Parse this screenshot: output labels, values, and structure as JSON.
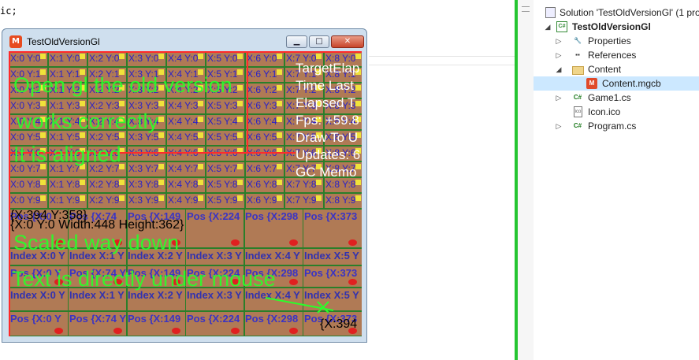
{
  "editor": {
    "code_fragment": "ic;"
  },
  "solution_explorer": {
    "items": [
      {
        "label": "Solution 'TestOldVersionGl' (1 pro",
        "icon": "solution-icon"
      },
      {
        "label": "TestOldVersionGl",
        "icon": "csharp-project-icon"
      },
      {
        "label": "Properties",
        "icon": "wrench-icon"
      },
      {
        "label": "References",
        "icon": "references-icon"
      },
      {
        "label": "Content",
        "icon": "folder-icon"
      },
      {
        "label": "Content.mgcb",
        "icon": "monogame-icon"
      },
      {
        "label": "Game1.cs",
        "icon": "csharp-file-icon"
      },
      {
        "label": "Icon.ico",
        "icon": "image-file-icon"
      },
      {
        "label": "Program.cs",
        "icon": "csharp-file-icon"
      }
    ]
  },
  "game_window": {
    "title": "TestOldVersionGl",
    "icon_glyph": "M",
    "buttons": {
      "minimize": "▁",
      "maximize": "□",
      "close": "✕"
    },
    "grid_labels": [
      [
        "X:0 Y:0",
        "X:1 Y:0",
        "X:2 Y:0",
        "X:3 Y:0",
        "X:4 Y:0",
        "X:5 Y:0",
        "X:6 Y:0",
        "X:7 Y:0",
        "X:8 Y:0"
      ],
      [
        "X:0 Y:1",
        "X:1 Y:1",
        "X:2 Y:1",
        "X:3 Y:1",
        "X:4 Y:1",
        "X:5 Y:1",
        "X:6 Y:1",
        "X:7 Y:1",
        "X:8 Y:1"
      ],
      [
        "X:0 Y:2",
        "X:1 Y:2",
        "X:2 Y:2",
        "X:3 Y:2",
        "X:4 Y:2",
        "X:5 Y:2",
        "X:6 Y:2",
        "X:7 Y:2",
        "X:8 Y:2"
      ],
      [
        "X:0 Y:3",
        "X:1 Y:3",
        "X:2 Y:3",
        "X:3 Y:3",
        "X:4 Y:3",
        "X:5 Y:3",
        "X:6 Y:3",
        "X:7 Y:3",
        "X:8 Y:3"
      ],
      [
        "X:0 Y:4",
        "X:1 Y:4",
        "X:2 Y:4",
        "X:3 Y:4",
        "X:4 Y:4",
        "X:5 Y:4",
        "X:6 Y:4",
        "X:7 Y:4",
        "X:8 Y:4"
      ],
      [
        "X:0 Y:5",
        "X:1 Y:5",
        "X:2 Y:5",
        "X:3 Y:5",
        "X:4 Y:5",
        "X:5 Y:5",
        "X:6 Y:5",
        "X:7 Y:5",
        "X:8 Y:5"
      ],
      [
        "X:0 Y:6",
        "X:1 Y:6",
        "X:2 Y:6",
        "X:3 Y:6",
        "X:4 Y:6",
        "X:5 Y:6",
        "X:6 Y:6",
        "X:7 Y:6",
        "X:8 Y:6"
      ],
      [
        "X:0 Y:7",
        "X:1 Y:7",
        "X:2 Y:7",
        "X:3 Y:7",
        "X:4 Y:7",
        "X:5 Y:7",
        "X:6 Y:7",
        "X:7 Y:7",
        "X:8 Y:7"
      ],
      [
        "X:0 Y:8",
        "X:1 Y:8",
        "X:2 Y:8",
        "X:3 Y:8",
        "X:4 Y:8",
        "X:5 Y:8",
        "X:6 Y:8",
        "X:7 Y:8",
        "X:8 Y:8"
      ],
      [
        "X:0 Y:9",
        "X:1 Y:9",
        "X:2 Y:9",
        "X:3 Y:9",
        "X:4 Y:9",
        "X:5 Y:9",
        "X:6 Y:9",
        "X:7 Y:9",
        "X:8 Y:9"
      ]
    ],
    "tile_rows": [
      [
        "Pos {X:0",
        "Pos {X:74",
        "Pos {X:149",
        "Pos {X:224",
        "Pos {X:298",
        "Pos {X:373"
      ],
      [
        "Index X:0 Y",
        "Index X:1 Y",
        "Index X:2 Y",
        "Index X:3 Y",
        "Index X:4 Y",
        "Index X:5 Y"
      ],
      [
        "Pos {X:0 Y",
        "Pos {X:74 Y",
        "Pos {X:149",
        "Pos {X:224",
        "Pos {X:298",
        "Pos {X:373"
      ],
      [
        "Index X:0 Y",
        "Index X:1 Y",
        "Index X:2 Y",
        "Index X:3 Y",
        "Index X:4 Y",
        "Index X:5 Y"
      ],
      [
        "Pos {X:0 Y",
        "Pos {X:74 Y",
        "Pos {X:149",
        "Pos {X:224",
        "Pos {X:298",
        "Pos {X:373"
      ]
    ],
    "overlay_text": {
      "line1": "Open gl the old version",
      "line2": "works correctly",
      "line3": "It is aligned",
      "line4": "Scaled way down",
      "line5": "Text is directly under mouse"
    },
    "stats": [
      "TargetElap",
      "Time Last",
      "Elapsed T",
      "Fps: +59.8",
      "Draw To U",
      "Updates: 6",
      "GC Memo"
    ],
    "coord_top": "{X:394 Y:358}",
    "rect_info": "{X:0 Y:0 Width:448 Height:362}",
    "mouse_coord": "{X:394"
  }
}
